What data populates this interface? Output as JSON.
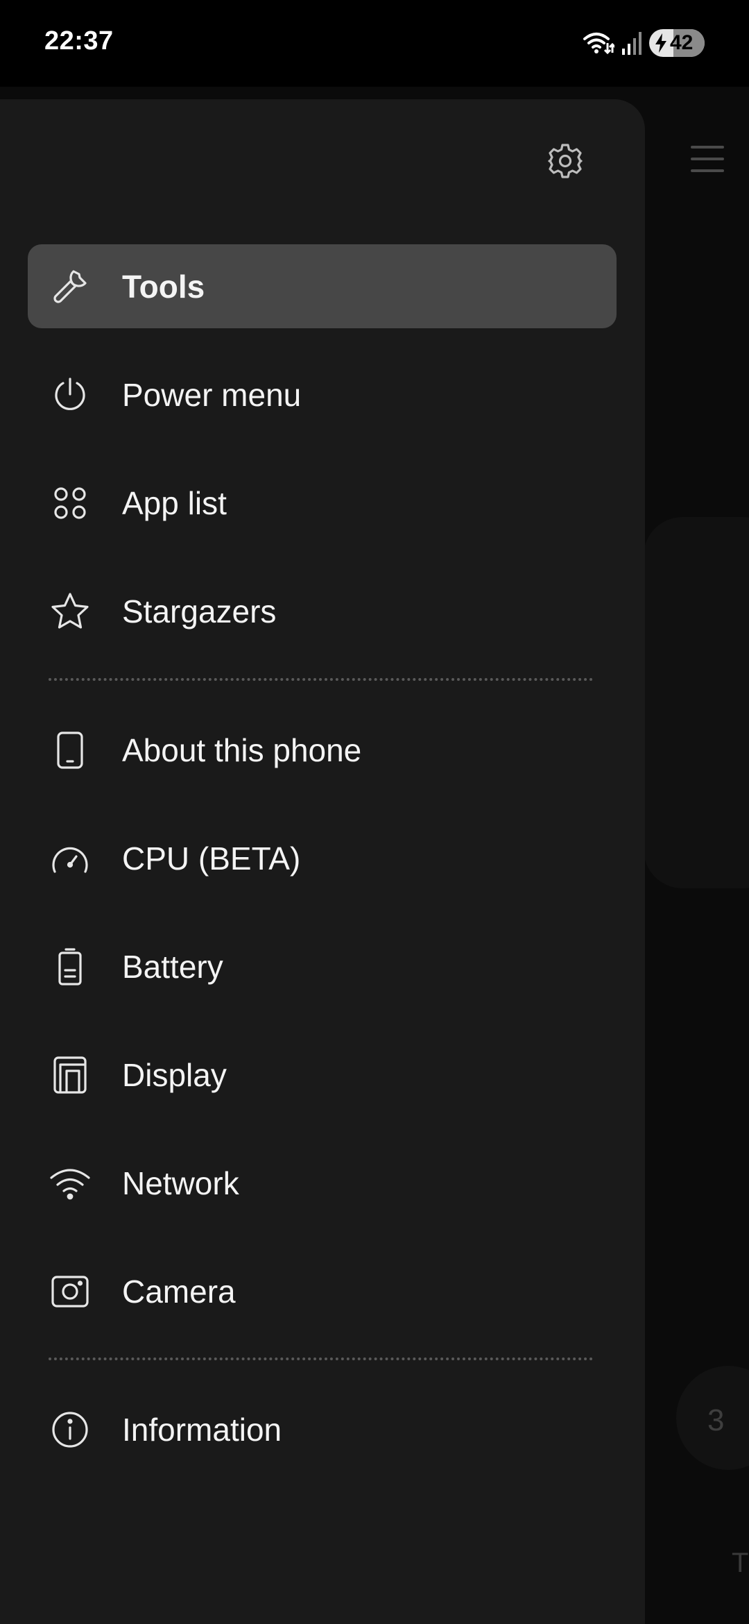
{
  "status_bar": {
    "time": "22:37",
    "battery_level": "42",
    "icons": [
      "wifi-data-icon",
      "signal-icon",
      "battery-charging-icon"
    ]
  },
  "background": {
    "circle_label": "3",
    "edge_letter": "T"
  },
  "drawer": {
    "settings_icon": "gear-icon",
    "groups": [
      [
        {
          "label": "Tools",
          "icon": "wrench-icon",
          "active": true
        },
        {
          "label": "Power menu",
          "icon": "power-icon"
        },
        {
          "label": "App list",
          "icon": "app-grid-icon"
        },
        {
          "label": "Stargazers",
          "icon": "star-icon"
        }
      ],
      [
        {
          "label": "About this phone",
          "icon": "phone-icon"
        },
        {
          "label": "CPU (BETA)",
          "icon": "speedometer-icon"
        },
        {
          "label": "Battery",
          "icon": "battery-icon"
        },
        {
          "label": "Display",
          "icon": "display-icon"
        },
        {
          "label": "Network",
          "icon": "wifi-icon"
        },
        {
          "label": "Camera",
          "icon": "camera-icon"
        }
      ],
      [
        {
          "label": "Information",
          "icon": "info-icon"
        }
      ]
    ]
  },
  "colors": {
    "drawer_bg": "#1a1a1a",
    "active_item_bg": "#474747",
    "text": "#f4f4f4",
    "screen_bg": "#000000"
  }
}
